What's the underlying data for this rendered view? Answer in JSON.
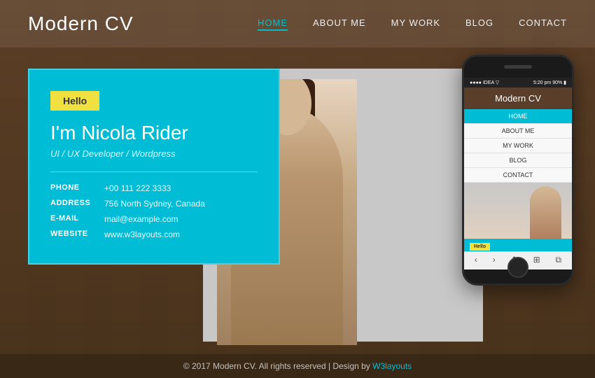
{
  "logo": {
    "text": "Modern CV"
  },
  "nav": {
    "items": [
      {
        "label": "HOME",
        "active": true
      },
      {
        "label": "ABOUT ME",
        "active": false
      },
      {
        "label": "MY WORK",
        "active": false
      },
      {
        "label": "BLOG",
        "active": false
      },
      {
        "label": "CONTACT",
        "active": false
      }
    ]
  },
  "hero": {
    "hello_badge": "Hello",
    "name": "I'm Nicola Rider",
    "title": "UI / UX Developer / Wordpress",
    "contacts": [
      {
        "label": "PHONE",
        "value": "+00 111 222 3333"
      },
      {
        "label": "ADDRESS",
        "value": "756 North Sydney, Canada"
      },
      {
        "label": "E-MAIL",
        "value": "mail@example.com"
      },
      {
        "label": "WEBSITE",
        "value": "www.w3layouts.com"
      }
    ]
  },
  "phone_mockup": {
    "status_left": "●●●● IDEA ▽",
    "status_right": "5:20 pm    90% ▮",
    "title": "Modern CV",
    "nav_items": [
      {
        "label": "HOME",
        "active": true
      },
      {
        "label": "ABOUT ME",
        "active": false
      },
      {
        "label": "MY WORK",
        "active": false
      },
      {
        "label": "BLOG",
        "active": false
      },
      {
        "label": "CONTACT",
        "active": false
      }
    ],
    "hello_badge": "Hello"
  },
  "footer": {
    "text": "© 2017 Modern CV. All rights reserved | Design by ",
    "link_text": "W3layouts"
  }
}
